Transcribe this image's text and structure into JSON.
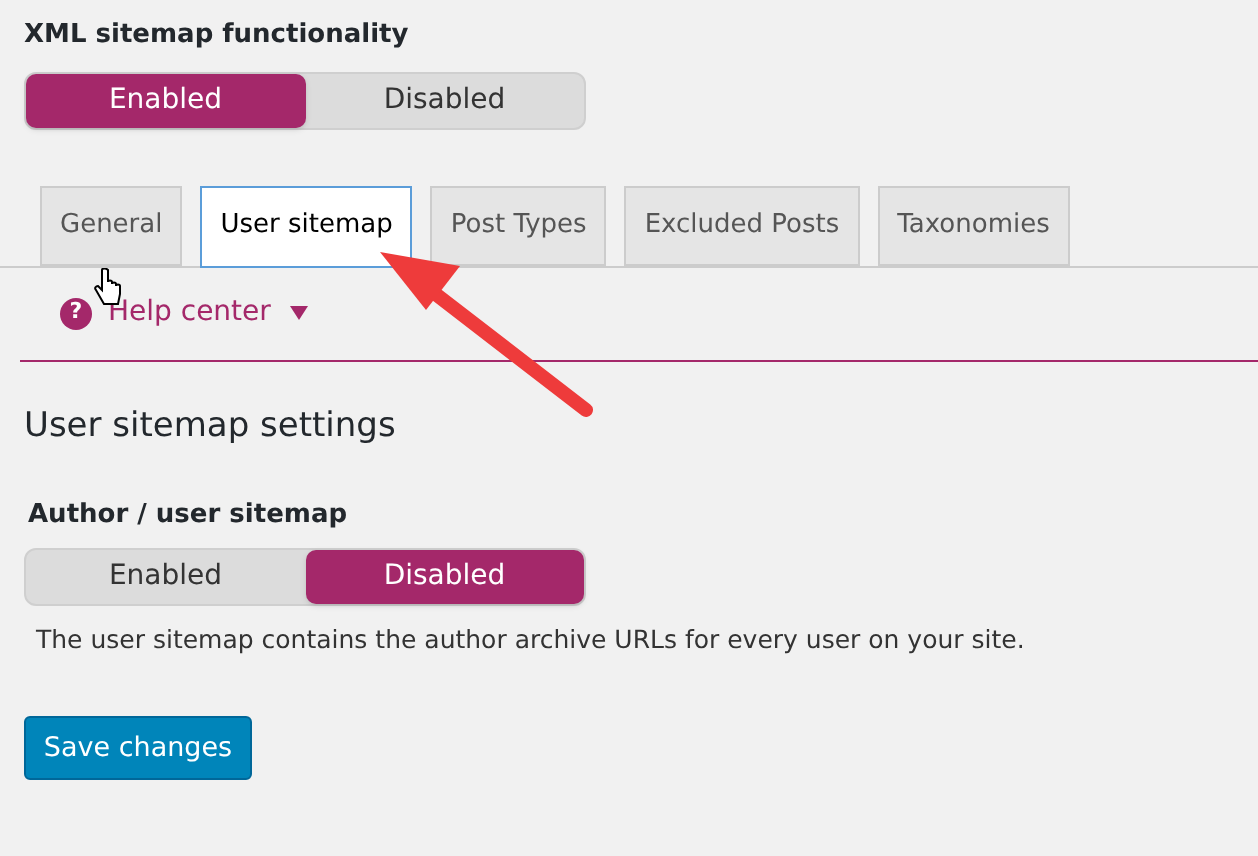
{
  "feature": {
    "label": "XML sitemap functionality",
    "options": [
      {
        "label": "Enabled",
        "selected": true
      },
      {
        "label": "Disabled",
        "selected": false
      }
    ]
  },
  "tabs": [
    {
      "label": "General",
      "selected": false
    },
    {
      "label": "User sitemap",
      "selected": true
    },
    {
      "label": "Post Types",
      "selected": false
    },
    {
      "label": "Excluded Posts",
      "selected": false
    },
    {
      "label": "Taxonomies",
      "selected": false
    }
  ],
  "help": {
    "icon": "?",
    "label": "Help center",
    "expanded": false
  },
  "section": {
    "heading": "User sitemap settings",
    "label": "Author / user sitemap",
    "options": [
      {
        "label": "Enabled",
        "selected": false
      },
      {
        "label": "Disabled",
        "selected": true
      }
    ],
    "description": "The user sitemap contains the author archive URLs for every user on your site."
  },
  "save_button": "Save changes"
}
